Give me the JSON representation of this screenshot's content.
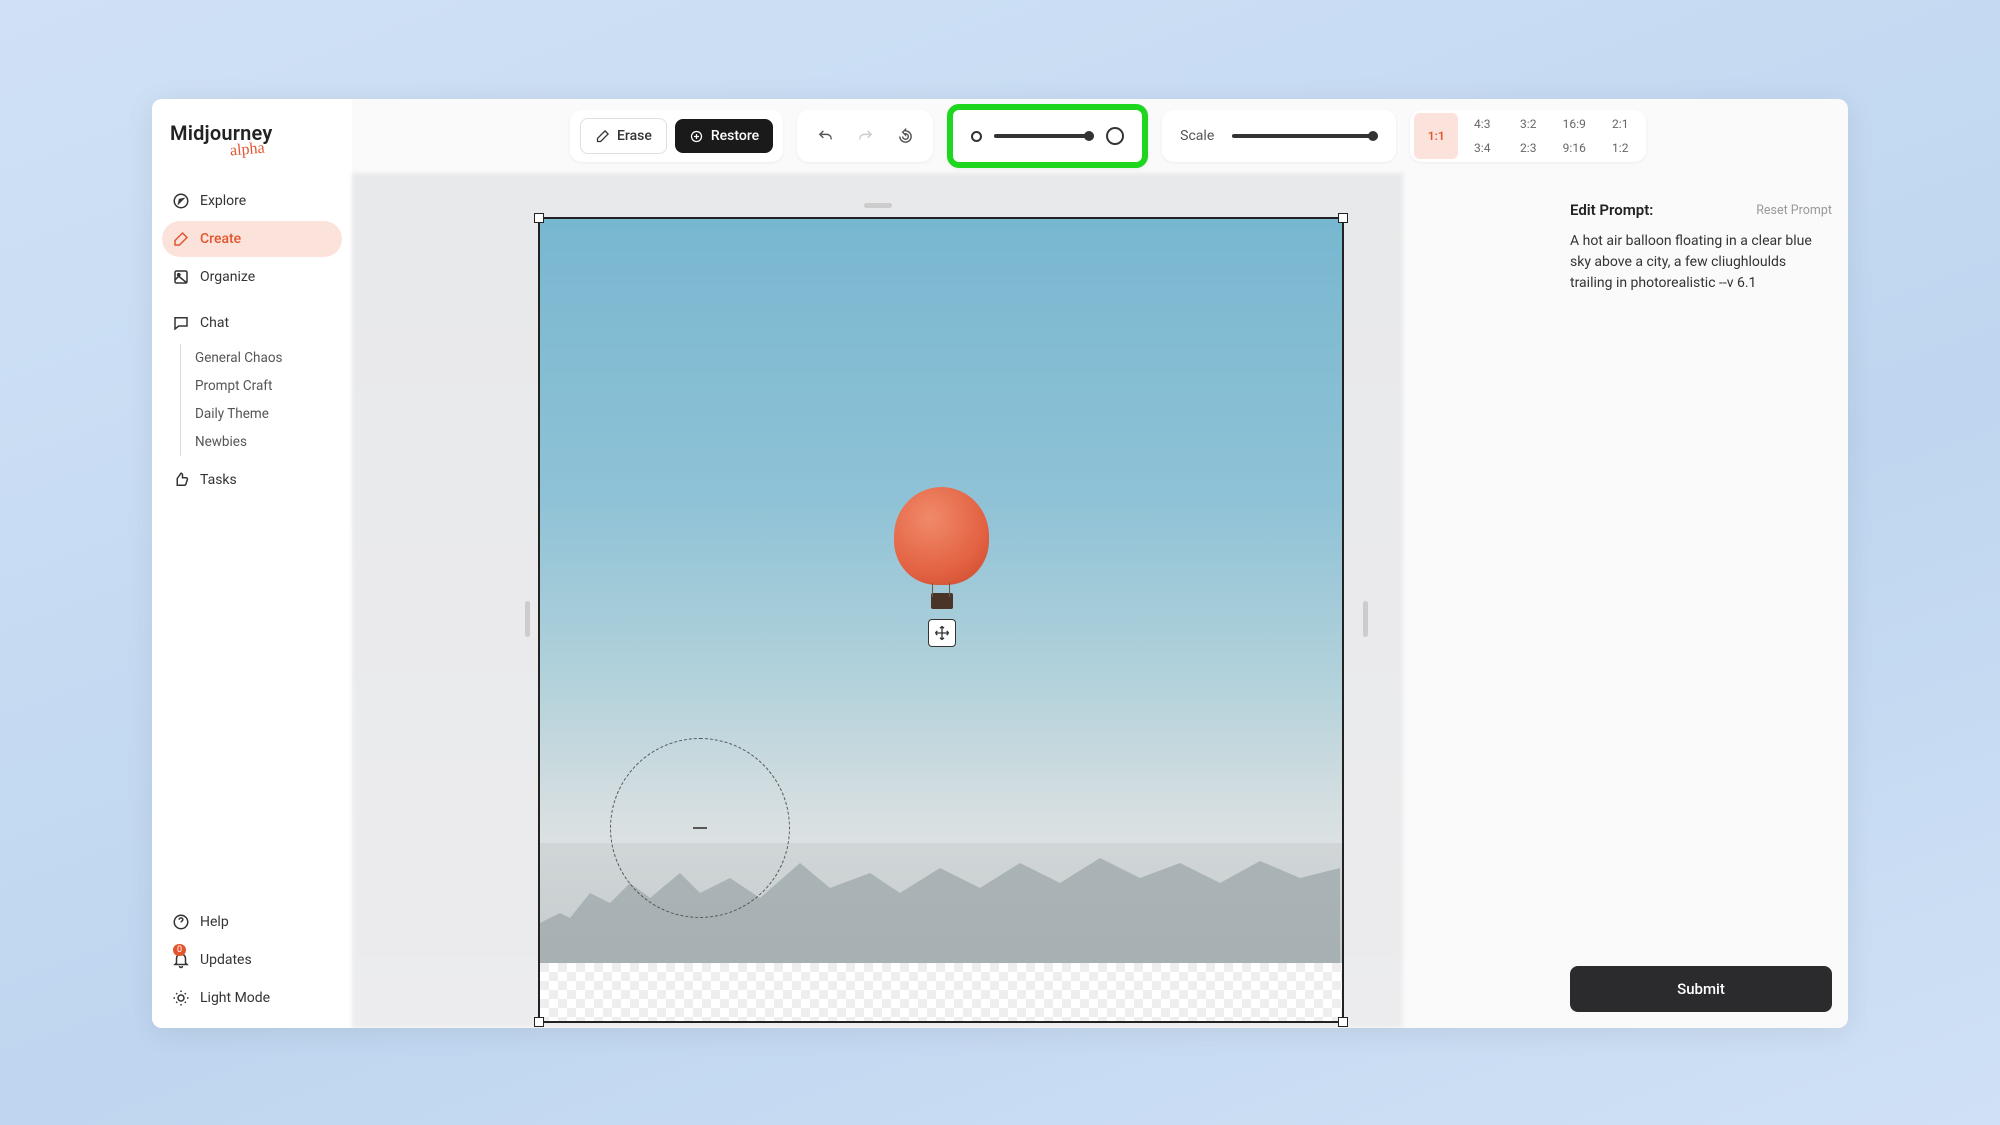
{
  "logo": {
    "main": "Midjourney",
    "sub": "alpha"
  },
  "sidebar": {
    "explore": "Explore",
    "create": "Create",
    "organize": "Organize",
    "chat": "Chat",
    "tasks": "Tasks",
    "chat_subs": [
      "General Chaos",
      "Prompt Craft",
      "Daily Theme",
      "Newbies"
    ],
    "help": "Help",
    "updates": "Updates",
    "updates_badge": "0",
    "light_mode": "Light Mode"
  },
  "toolbar": {
    "erase": "Erase",
    "restore": "Restore",
    "scale_label": "Scale"
  },
  "aspect_ratios": {
    "active": "1:1",
    "grid": [
      "4:3",
      "3:2",
      "16:9",
      "2:1",
      "3:4",
      "2:3",
      "9:16",
      "1:2"
    ]
  },
  "right_panel": {
    "title": "Edit Prompt:",
    "reset": "Reset Prompt",
    "prompt": "A hot air balloon floating in a clear blue sky above a city, a few cliughloulds trailing in photorealistic --v 6.1",
    "submit": "Submit"
  }
}
